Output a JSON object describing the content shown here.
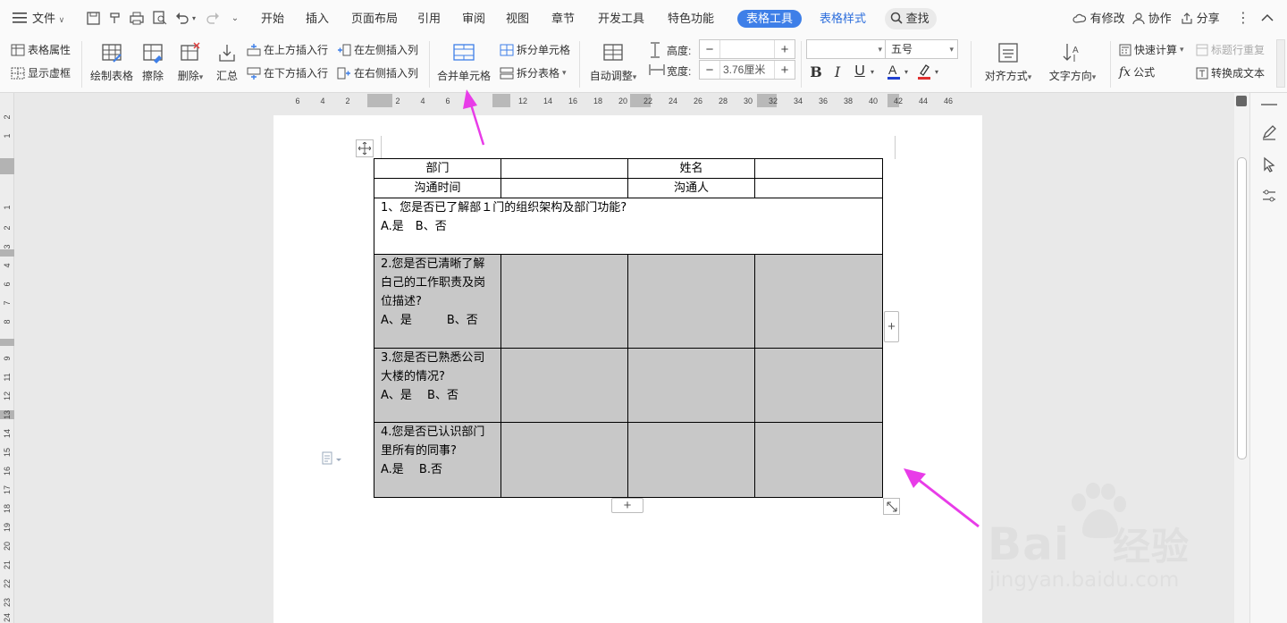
{
  "menubar": {
    "file": "文件",
    "tabs": [
      "开始",
      "插入",
      "页面布局",
      "引用",
      "审阅",
      "视图",
      "章节",
      "开发工具",
      "特色功能",
      "表格工具",
      "表格样式"
    ],
    "search": "查找",
    "right": {
      "modified": "有修改",
      "collab": "协作",
      "share": "分享"
    }
  },
  "ribbon": {
    "table_props": "表格属性",
    "show_grid": "显示虚框",
    "draw_table": "绘制表格",
    "erase": "擦除",
    "delete": "删除",
    "summary": "汇总",
    "insert_above": "在上方插入行",
    "insert_below": "在下方插入行",
    "insert_left": "在左侧插入列",
    "insert_right": "在右侧插入列",
    "merge_cells": "合并单元格",
    "split_cells": "拆分单元格",
    "split_table": "拆分表格",
    "auto_adjust": "自动调整",
    "height_label": "高度:",
    "height_value": "",
    "width_label": "宽度:",
    "width_value": "3.76厘米",
    "font_name": "",
    "font_size": "五号",
    "align": "对齐方式",
    "text_dir": "文字方向",
    "quick_calc": "快速计算",
    "repeat_header": "标题行重复",
    "formula": "公式",
    "to_text": "转换成文本"
  },
  "ruler": {
    "top": [
      "6",
      "4",
      "2",
      "2",
      "4",
      "6",
      "12",
      "14",
      "16",
      "18",
      "20",
      "22",
      "24",
      "26",
      "28",
      "30",
      "32",
      "34",
      "36",
      "38",
      "40",
      "42",
      "44",
      "46"
    ],
    "left": [
      "2",
      "1",
      "1",
      "2",
      "3",
      "4",
      "6",
      "7",
      "8",
      "9",
      "11",
      "12",
      "13",
      "14",
      "15",
      "16",
      "17",
      "18",
      "19",
      "20",
      "21",
      "22",
      "23",
      "24"
    ]
  },
  "table": {
    "r1": [
      "部门",
      "",
      "姓名",
      ""
    ],
    "r2": [
      "沟通时间",
      "",
      "沟通人",
      ""
    ],
    "q1": {
      "q": "1、您是否已了解部１门的组织架构及部门功能?",
      "a": "A.是　B、否"
    },
    "q2": {
      "q": "2.您是否已清晰了解白己的工作职责及岗位描述?",
      "a": "A、是　　　B、否"
    },
    "q3": {
      "q": "3.您是否已熟悉公司大楼的情况?",
      "a": "A、是　 B、否"
    },
    "q4": {
      "q": "4.您是否已认识部门里所有的同事?",
      "a": "A.是　 B.否"
    }
  },
  "colors": {
    "accent": "#3e7fe8",
    "arrow": "#e83ce8",
    "cell_gray": "#c8c8c8"
  },
  "watermark": {
    "brand": "Bai",
    "brand2": "经验",
    "url": "jingyan.baidu.com"
  }
}
